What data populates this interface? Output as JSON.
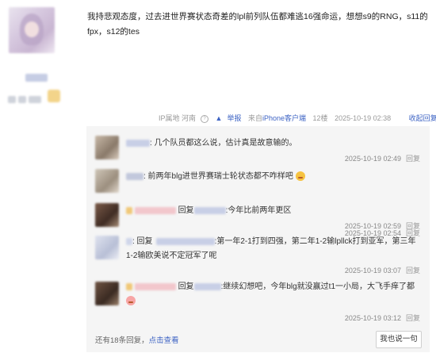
{
  "post": {
    "content": "我持悲观态度，过去进世界赛状态奇差的lpl前列队伍都难逃16强命运，想想s9的RNG，s11的fpx，s12的tes"
  },
  "meta": {
    "ip_location": "IP属地 河南",
    "report": "举报",
    "source_prefix": "来自",
    "source_link": "iPhone客户端",
    "floor": "12楼",
    "timestamp": "2025-10-19 02:38",
    "collapse_replies": "收起回复"
  },
  "replies": [
    {
      "text": ": 几个队员都这么说，估计真是故意输的。",
      "time": "2025-10-19 02:49",
      "reply_label": "回复"
    },
    {
      "text": ": 前两年blg进世界赛瑞士轮状态都不咋样吧",
      "time": "2025-10-19 02:54",
      "reply_label": "回复"
    },
    {
      "prefix": "回复",
      "text": ":今年比前两年更区",
      "time": "2025-10-19 02:59",
      "reply_label": "回复"
    },
    {
      "prefix": ": 回复",
      "text": ":第一年2-1打到四强，第二年1-2输lpllck打到亚军，第三年1-2输欧美说不定冠军了呢",
      "time": "2025-10-19 03:07",
      "reply_label": "回复"
    },
    {
      "prefix": "回复",
      "text": ":继续幻想吧，今年blg就没赢过t1一小局，大飞手痒了都",
      "time": "2025-10-19 03:12",
      "reply_label": "回复"
    }
  ],
  "footer": {
    "more_prefix": "还有18条回复，",
    "more_link": "点击查看",
    "say_button": "我也说一句"
  }
}
